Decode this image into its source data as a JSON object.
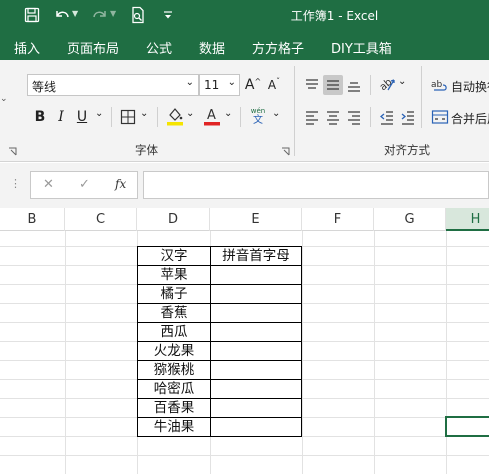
{
  "app": {
    "title": "工作簿1  -  Excel"
  },
  "menu": {
    "tabs": [
      "插入",
      "页面布局",
      "公式",
      "数据",
      "方方格子",
      "DIY工具箱"
    ]
  },
  "ribbon": {
    "font_name": "等线",
    "font_size": "11",
    "grow_font": "A",
    "shrink_font": "A",
    "bold": "B",
    "italic": "I",
    "underline": "U",
    "font_group_label": "字体",
    "align_group_label": "对齐方式",
    "wrap_text": "自动换行",
    "merge_center": "合并后居中",
    "phonetic_top": "wén",
    "phonetic_bottom": "文",
    "highlight_color": "#f5e400",
    "font_color": "#e02424"
  },
  "formula_bar": {
    "fx": "fx",
    "cancel": "✕",
    "enter": "✓",
    "value": ""
  },
  "sheet": {
    "columns": [
      "B",
      "C",
      "D",
      "E",
      "F",
      "G",
      "H"
    ],
    "active_column": "H",
    "table": {
      "header_d": "汉字",
      "header_e": "拼音首字母",
      "rows": [
        "苹果",
        "橘子",
        "香蕉",
        "西瓜",
        "火龙果",
        "猕猴桃",
        "哈密瓜",
        "百香果",
        "牛油果"
      ]
    }
  },
  "colors": {
    "accent": "#1f6e43",
    "ribbon_bg": "#f3f3f3"
  }
}
